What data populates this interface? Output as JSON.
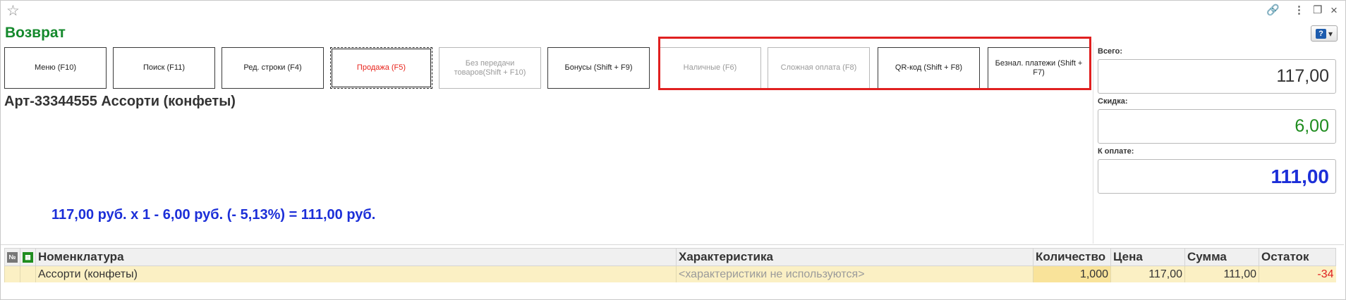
{
  "window": {
    "title": "Возврат",
    "icons": [
      "star-icon",
      "link-icon",
      "more-icon",
      "restore-icon",
      "close-icon"
    ],
    "help_button": {
      "icon": "?",
      "arrow": "▾"
    }
  },
  "buttons": [
    {
      "label": "Меню (F10)"
    },
    {
      "label": "Поиск (F11)"
    },
    {
      "label": "Ред. строки (F4)"
    },
    {
      "label": "Продажа (F5)"
    },
    {
      "label": "Без передачи товаров(Shift + F10)"
    },
    {
      "label": "Бонусы (Shift + F9)"
    },
    {
      "label": "Наличные (F6)"
    },
    {
      "label": "Сложная оплата (F8)"
    },
    {
      "label": "QR-код (Shift + F8)"
    },
    {
      "label": "Безнал. платежи (Shift + F7)"
    }
  ],
  "product": {
    "title": "Арт-33344555 Ассорти (конфеты)",
    "calculation": "117,00 руб. х 1  - 6,00 руб. (- 5,13%) = 111,00 руб."
  },
  "totals": {
    "total_label": "Всего:",
    "total_value": "117,00",
    "discount_label": "Скидка:",
    "discount_value": "6,00",
    "to_pay_label": "К оплате:",
    "to_pay_value": "111,00"
  },
  "colors": {
    "title_green": "#14892c",
    "highlight_red": "#e02020",
    "pay_blue": "#1c2fd8",
    "row_highlight": "#fbf0c4"
  },
  "table": {
    "headers": {
      "num": "№",
      "nomenclature": "Номенклатура",
      "characteristic": "Характеристика",
      "quantity": "Количество",
      "price": "Цена",
      "sum": "Сумма",
      "rest": "Остаток"
    },
    "rows": [
      {
        "nomenclature": "Ассорти (конфеты)",
        "characteristic": "<характеристики не используются>",
        "quantity": "1,000",
        "price": "117,00",
        "sum": "111,00",
        "rest": "-34"
      }
    ]
  }
}
